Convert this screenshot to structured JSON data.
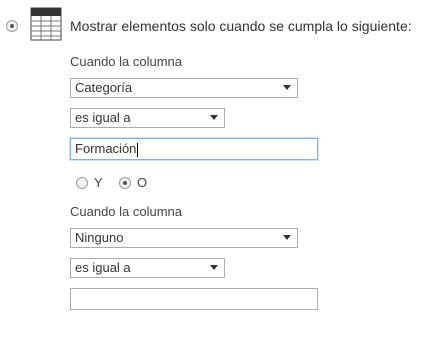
{
  "heading": "Mostrar elementos solo cuando se cumpla lo siguiente:",
  "filter1": {
    "column_label": "Cuando la columna",
    "column_value": "Categoría",
    "operator_value": "es igual a",
    "value_input": "Formación"
  },
  "logic": {
    "and_label": "Y",
    "or_label": "O",
    "selected": "O"
  },
  "filter2": {
    "column_label": "Cuando la columna",
    "column_value": "Ninguno",
    "operator_value": "es igual a",
    "value_input": ""
  },
  "colors": {
    "border": "#ababab",
    "focus_border": "#7eb4ea",
    "text": "#333333"
  },
  "icons": {
    "top_icon": "filter-table-icon",
    "dropdown": "dropdown-arrow-icon"
  }
}
